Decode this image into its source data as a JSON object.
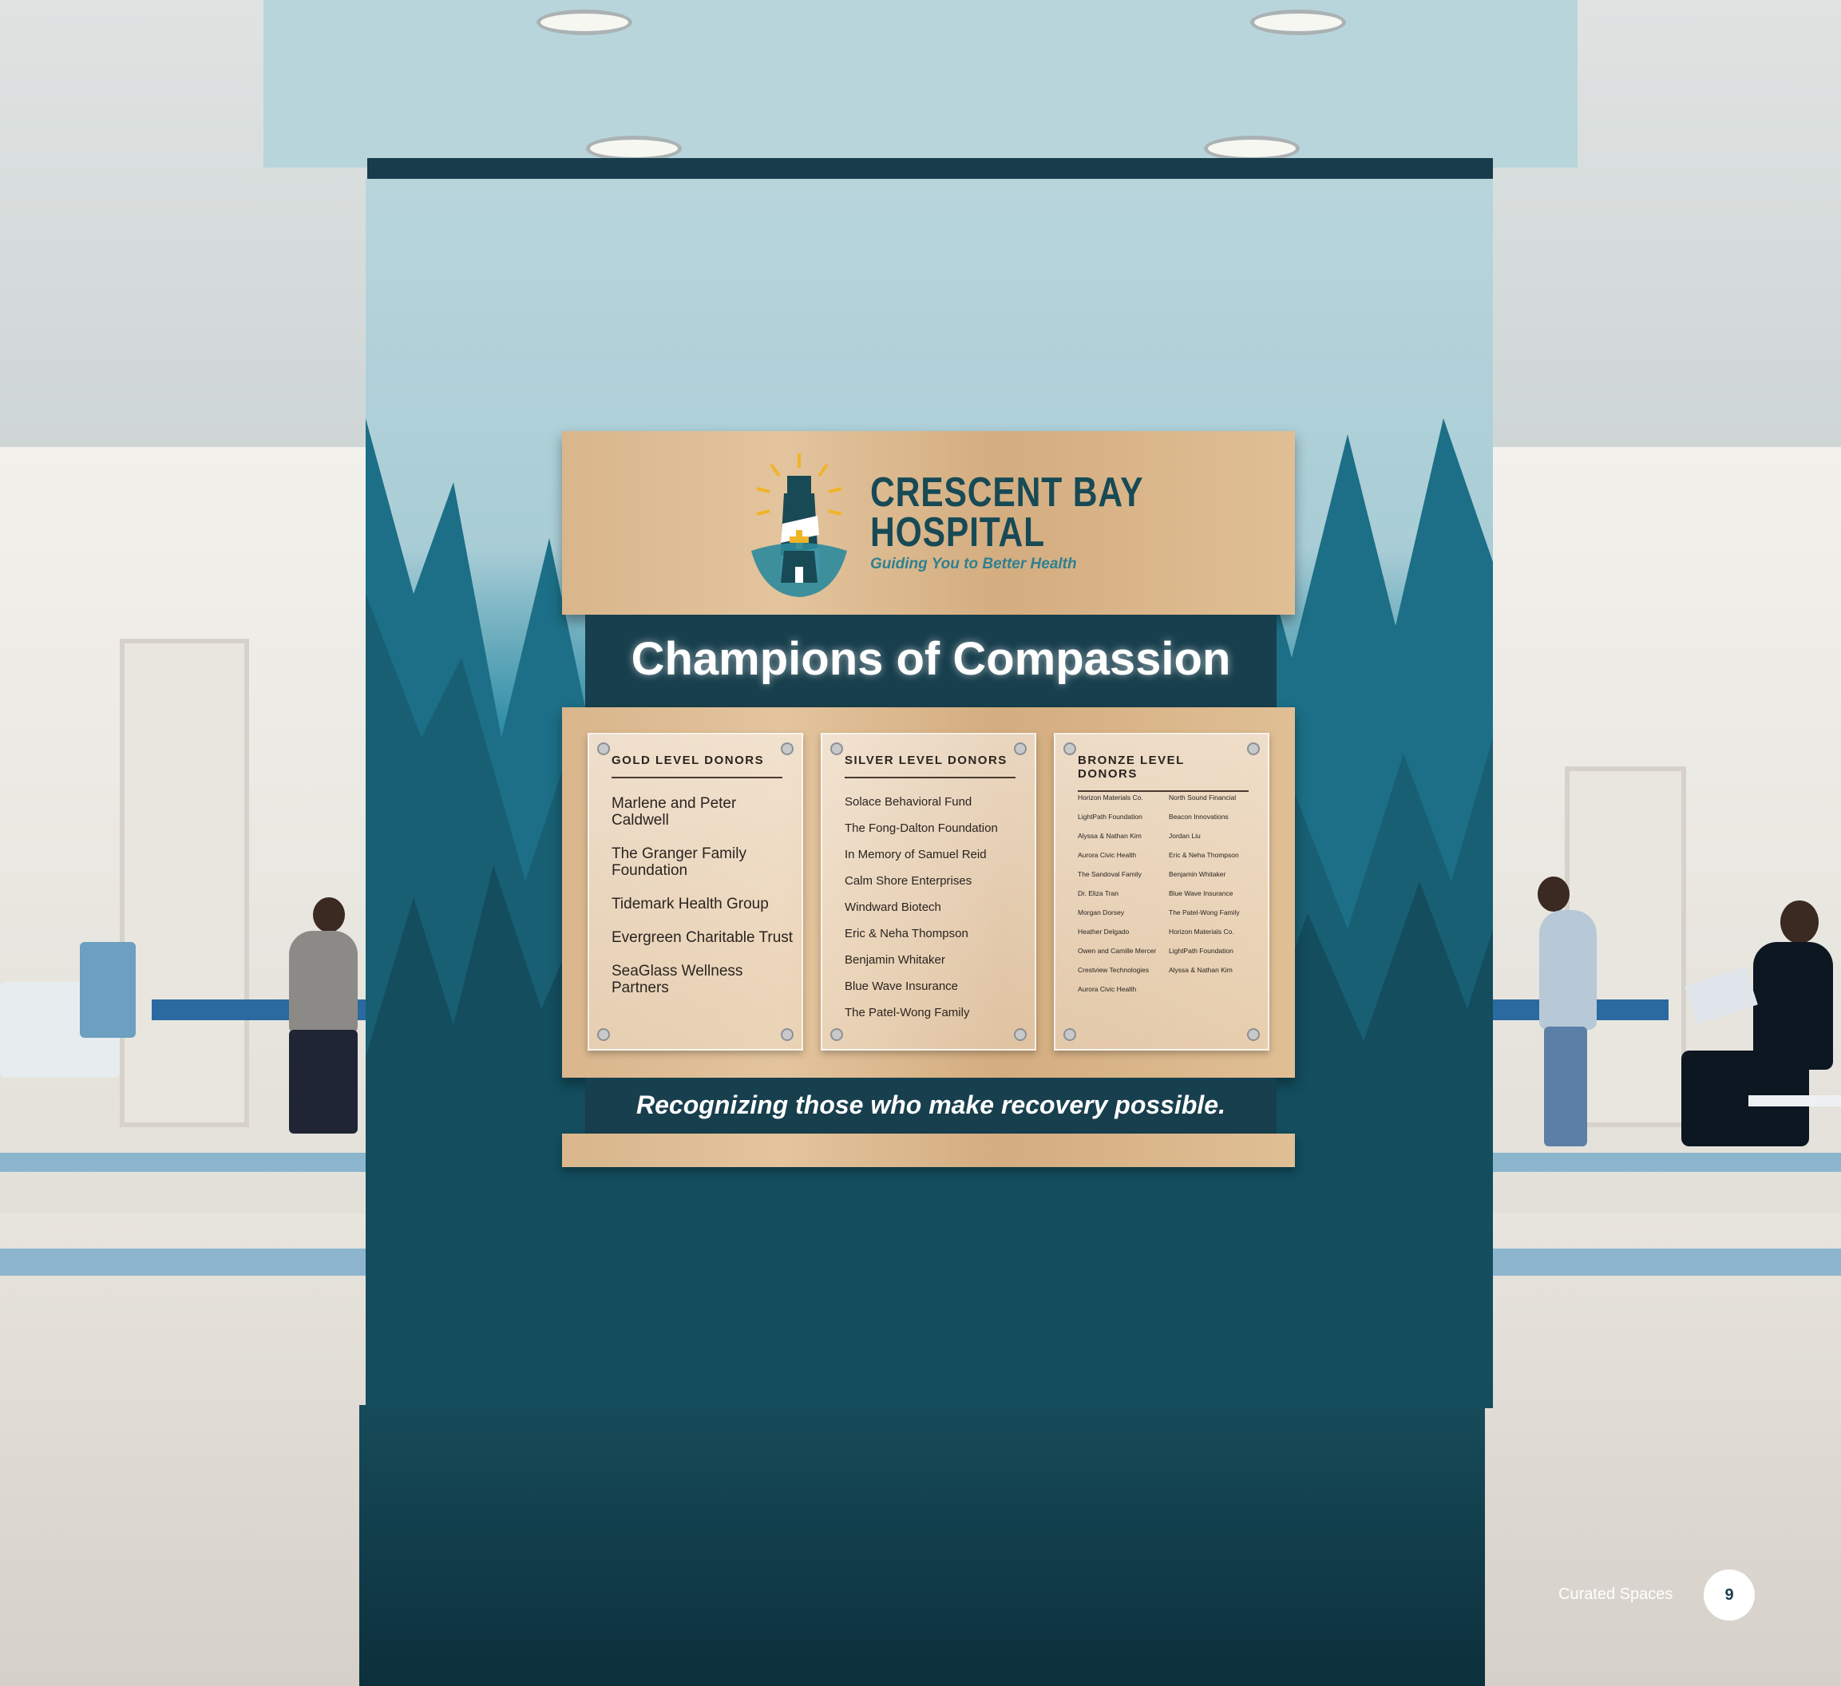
{
  "logo": {
    "name_line1": "CRESCENT BAY",
    "name_line2": "HOSPITAL",
    "tagline": "Guiding You to Better Health"
  },
  "sign": {
    "title": "Champions of Compassion",
    "subtitle": "Recognizing those who make recovery possible."
  },
  "gold": {
    "heading": "GOLD LEVEL DONORS",
    "donors": [
      "Marlene and Peter Caldwell",
      "The Granger Family Foundation",
      "Tidemark Health Group",
      "Evergreen Charitable Trust",
      "SeaGlass Wellness Partners"
    ]
  },
  "silver": {
    "heading": "SILVER LEVEL DONORS",
    "donors": [
      "Solace Behavioral Fund",
      "The Fong-Dalton Foundation",
      "In Memory of Samuel Reid",
      "Calm Shore Enterprises",
      "Windward Biotech",
      "Eric & Neha Thompson",
      "Benjamin Whitaker",
      "Blue Wave Insurance",
      "The Patel-Wong Family"
    ]
  },
  "bronze": {
    "heading": "BRONZE LEVEL DONORS",
    "col1": [
      "Horizon Materials Co.",
      "LightPath Foundation",
      "Alyssa & Nathan Kim",
      "Aurora Civic Health",
      "The Sandoval Family",
      "Dr. Eliza Tran",
      "Morgan Dorsey",
      "Heather Delgado",
      "Owen and Camille Mercer",
      "Crestview Technologies",
      "Aurora Civic Health"
    ],
    "col2": [
      "North Sound Financial",
      "Beacon Innovations",
      "Jordan Liu",
      "Eric & Neha Thompson",
      "Benjamin Whitaker",
      "Blue Wave Insurance",
      "The Patel-Wong Family",
      "Horizon Materials Co.",
      "LightPath Foundation",
      "Alyssa & Nathan Kim"
    ]
  },
  "footer": {
    "label": "Curated Spaces",
    "page_number": "9"
  },
  "colors": {
    "wall_light": "#b8d5dc",
    "wall_teal": "#1f7189",
    "band_dark": "#183f4d",
    "logo_navy": "#174a55",
    "logo_accent": "#f0b429"
  }
}
